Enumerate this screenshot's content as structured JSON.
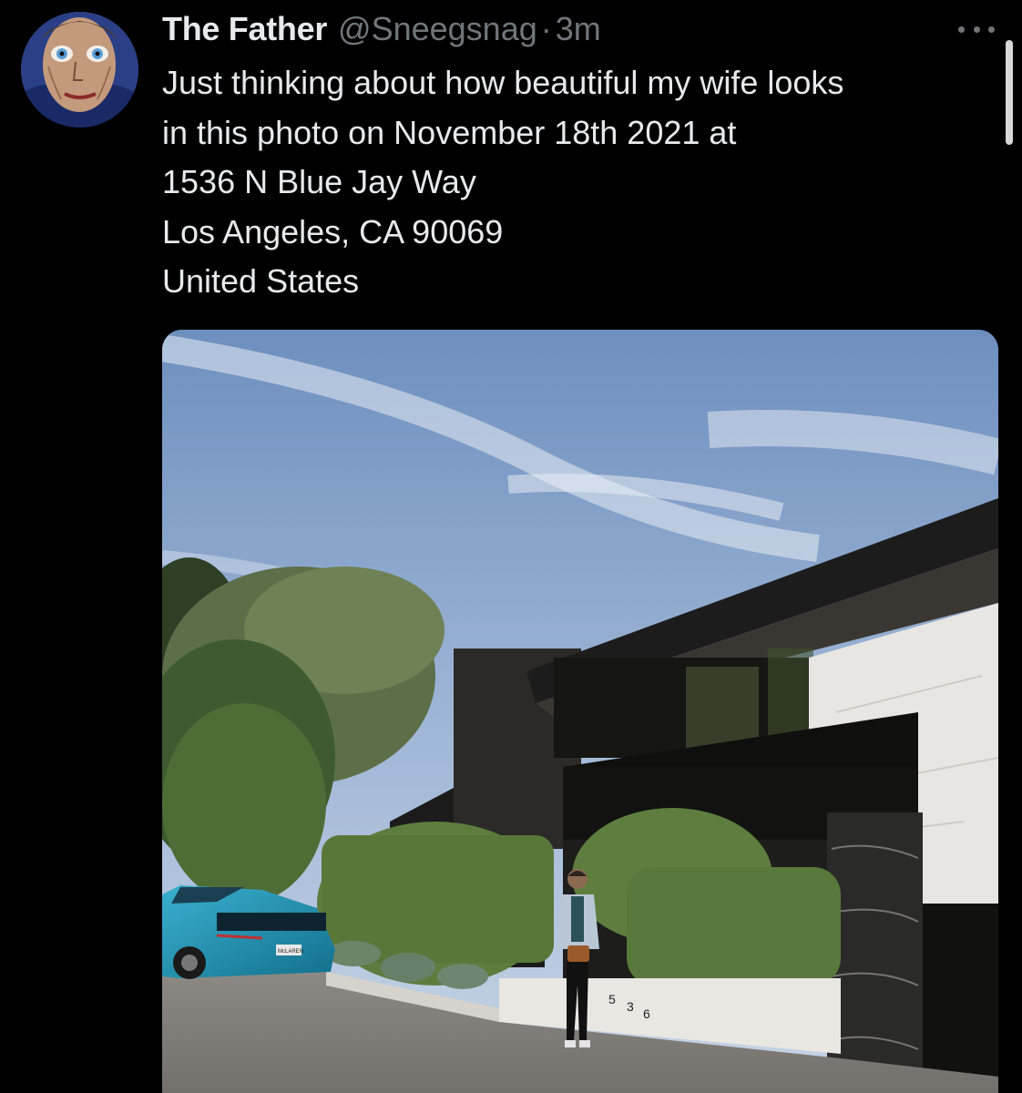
{
  "tweet": {
    "author": {
      "display_name": "The Father",
      "handle": "@Sneegsnag",
      "avatar": "avatar-image"
    },
    "separator": "·",
    "timestamp": "3m",
    "more_icon": "more-horizontal-icon",
    "text_lines": [
      "Just thinking about how beautiful my wife looks",
      "in this photo on November 18th 2021 at",
      "1536 N Blue Jay Way",
      "Los Angeles, CA  90069",
      "United States"
    ],
    "media": {
      "type": "photo",
      "house_number": [
        "5",
        "3",
        "6"
      ],
      "license_plate": "McLAREN"
    }
  }
}
